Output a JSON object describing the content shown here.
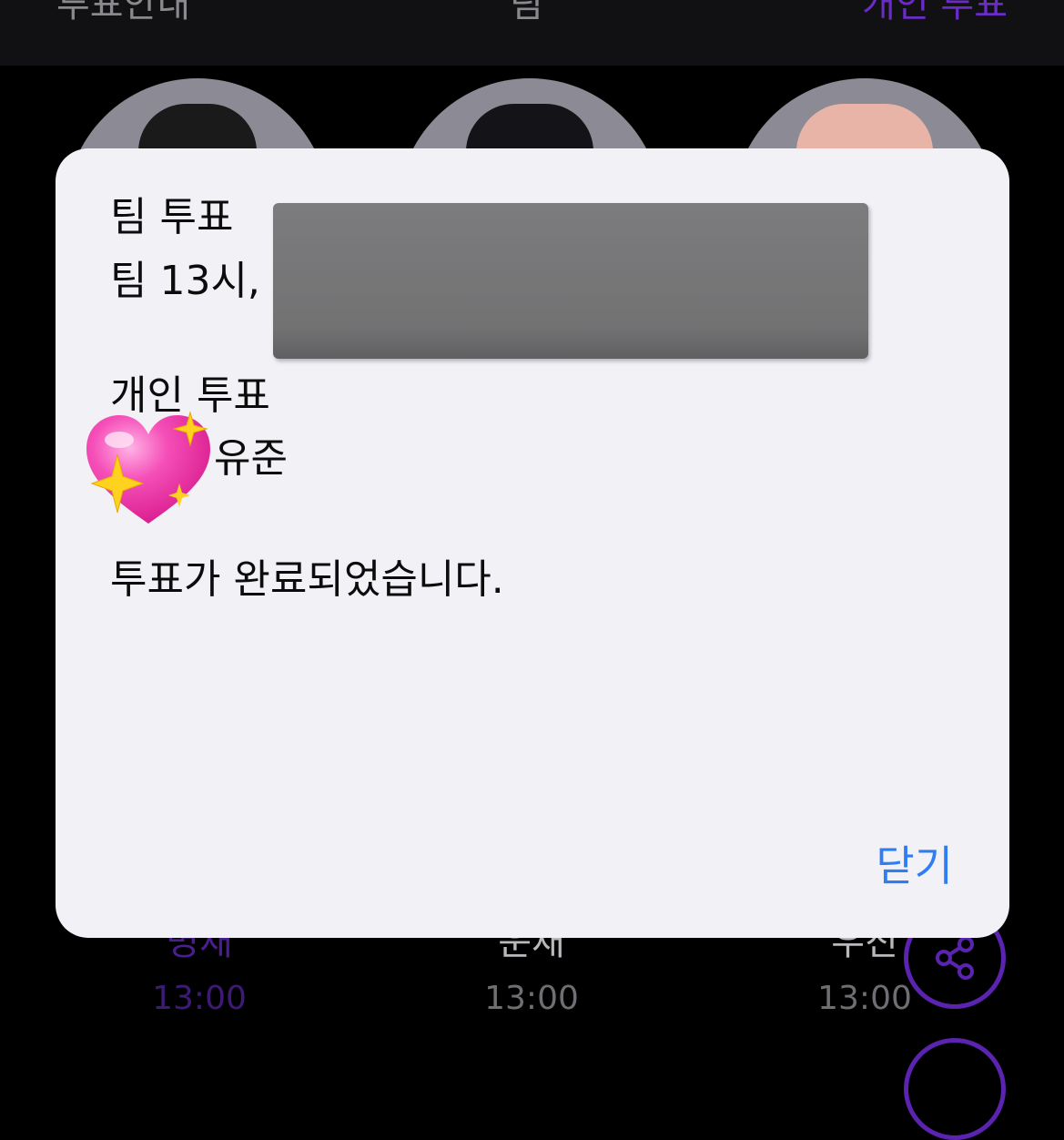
{
  "header": {
    "tabs": [
      {
        "label": "투표안내"
      },
      {
        "label": "팀"
      },
      {
        "label": "개인 투표"
      }
    ],
    "active_tab": "개인 투표"
  },
  "members": [
    {
      "name": "명재",
      "time": "13:00"
    },
    {
      "name": "운재",
      "time": "13:00"
    },
    {
      "name": "우진",
      "time": "13:00"
    }
  ],
  "icons": [
    "share-icon"
  ],
  "colors": {
    "accent": "#5a23b0",
    "link": "#2f7df3",
    "modal_bg": "#f2f1f6",
    "redaction": "#767677"
  },
  "modal": {
    "team_heading": "팀 투표",
    "team_vote": "팀 13시,",
    "personal_heading": "개인 투표",
    "personal_vote": "유준",
    "completion_message": "투표가 완료되었습니다.",
    "close_label": "닫기"
  }
}
